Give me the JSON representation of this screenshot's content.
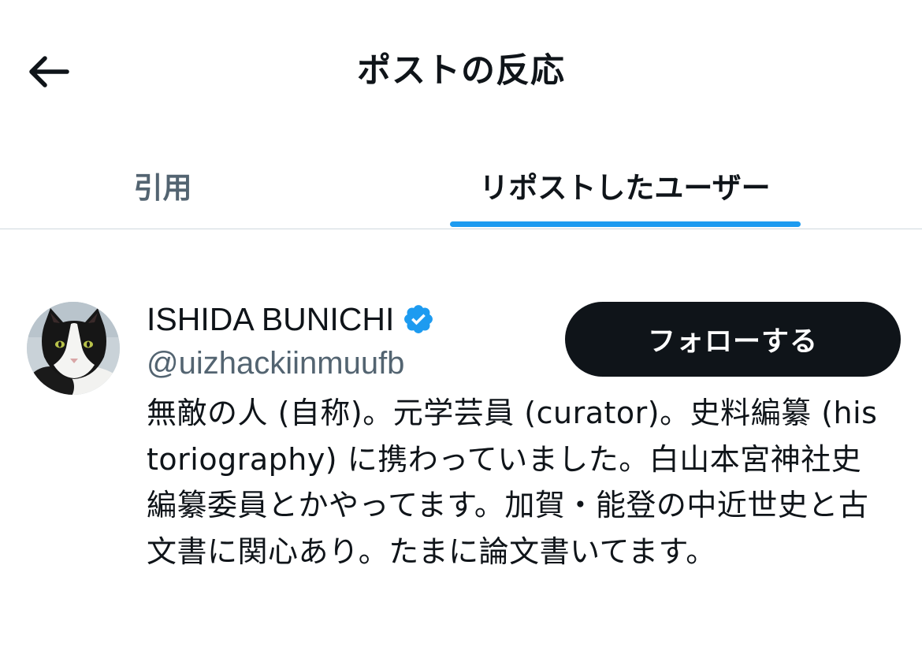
{
  "header": {
    "title": "ポストの反応",
    "back_icon": "arrow-left-icon"
  },
  "tabs": [
    {
      "label": "引用",
      "selected": false
    },
    {
      "label": "リポストしたユーザー",
      "selected": true
    }
  ],
  "colors": {
    "accent": "#1d9bf0",
    "text_primary": "#0f1419",
    "text_secondary": "#536471",
    "follow_button_bg": "#0f1419",
    "divider": "#cfd9de"
  },
  "user": {
    "display_name": "ISHIDA BUNICHI",
    "verified": true,
    "verified_icon": "verified-badge-icon",
    "handle": "@uizhackiinmuufb",
    "follow_label": "フォローする",
    "avatar_icon": "cat-avatar",
    "bio": "無敵の人 (自称)。元学芸員 (curator)。史料編纂 (historiography) に携わっていました。白山本宮神社史編纂委員とかやってます。加賀・能登の中近世史と古文書に関心あり。たまに論文書いてます。"
  }
}
